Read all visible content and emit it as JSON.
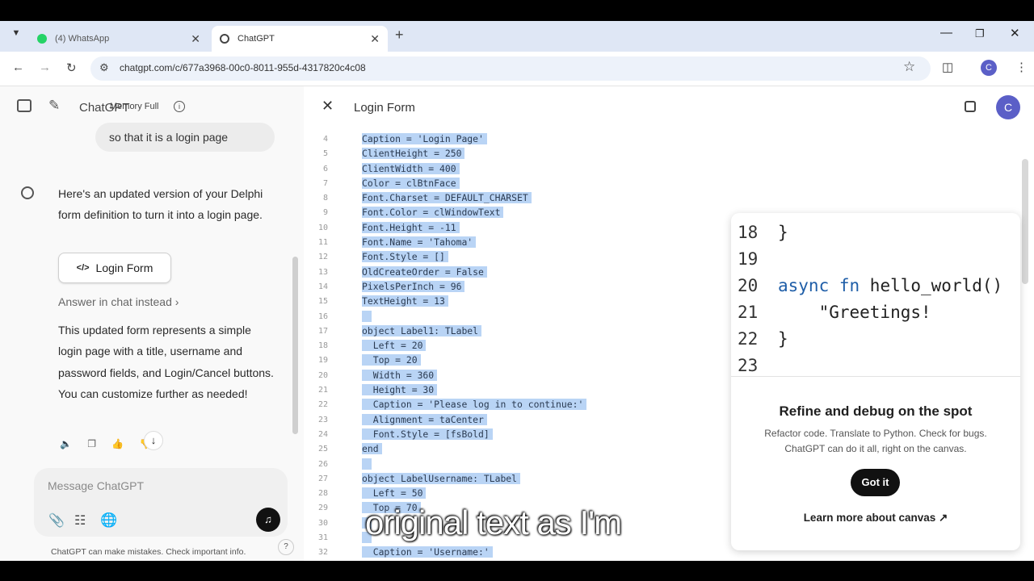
{
  "browser": {
    "tabs": [
      {
        "label": "(4) WhatsApp",
        "active": false
      },
      {
        "label": "ChatGPT",
        "active": true
      }
    ],
    "url": "chatgpt.com/c/677a3968-00c0-8011-955d-4317820c4c08",
    "profile_initial": "C"
  },
  "sidebar": {
    "app_name": "ChatGPT",
    "memory_label": "Memory Full",
    "user_message_tail": "so that it is a login page",
    "assistant_intro": "Here's an updated version of your Delphi form definition to turn it into a login page.",
    "card_label": "Login Form",
    "answer_in_chat": "Answer in chat instead",
    "assistant_body": "This updated form represents a simple login page with a title, username and password fields, and Login/Cancel buttons. You can customize further as needed!",
    "composer_placeholder": "Message ChatGPT",
    "disclaimer": "ChatGPT can make mistakes. Check important info.",
    "help": "?"
  },
  "canvas": {
    "title": "Login Form",
    "avatar_initial": "C",
    "code_lines": [
      {
        "n": "4",
        "text": "Caption = 'Login Page'"
      },
      {
        "n": "5",
        "text": "ClientHeight = 250"
      },
      {
        "n": "6",
        "text": "ClientWidth = 400"
      },
      {
        "n": "7",
        "text": "Color = clBtnFace"
      },
      {
        "n": "8",
        "text": "Font.Charset = DEFAULT_CHARSET"
      },
      {
        "n": "9",
        "text": "Font.Color = clWindowText"
      },
      {
        "n": "10",
        "text": "Font.Height = -11"
      },
      {
        "n": "11",
        "text": "Font.Name = 'Tahoma'"
      },
      {
        "n": "12",
        "text": "Font.Style = []"
      },
      {
        "n": "13",
        "text": "OldCreateOrder = False"
      },
      {
        "n": "14",
        "text": "PixelsPerInch = 96"
      },
      {
        "n": "15",
        "text": "TextHeight = 13"
      },
      {
        "n": "16",
        "text": ""
      },
      {
        "n": "17",
        "text": "object Label1: TLabel"
      },
      {
        "n": "18",
        "text": "  Left = 20"
      },
      {
        "n": "19",
        "text": "  Top = 20"
      },
      {
        "n": "20",
        "text": "  Width = 360"
      },
      {
        "n": "21",
        "text": "  Height = 30"
      },
      {
        "n": "22",
        "text": "  Caption = 'Please log in to continue:'"
      },
      {
        "n": "23",
        "text": "  Alignment = taCenter"
      },
      {
        "n": "24",
        "text": "  Font.Style = [fsBold]"
      },
      {
        "n": "25",
        "text": "end"
      },
      {
        "n": "26",
        "text": ""
      },
      {
        "n": "27",
        "text": "object LabelUsername: TLabel"
      },
      {
        "n": "28",
        "text": "  Left = 50"
      },
      {
        "n": "29",
        "text": "  Top = 70"
      },
      {
        "n": "30",
        "text": ""
      },
      {
        "n": "31",
        "text": ""
      },
      {
        "n": "32",
        "text": "  Caption = 'Username:'"
      }
    ]
  },
  "popup": {
    "code_lines": [
      {
        "n": "18",
        "text": "}"
      },
      {
        "n": "19",
        "text": ""
      },
      {
        "n": "20",
        "kw": "async fn ",
        "text": "hello_world()"
      },
      {
        "n": "21",
        "text": "    \"Greetings!"
      },
      {
        "n": "22",
        "text": "}"
      },
      {
        "n": "23",
        "text": ""
      }
    ],
    "title": "Refine and debug on the spot",
    "body": "Refactor code. Translate to Python. Check for bugs. ChatGPT can do it all, right on the canvas.",
    "got_it": "Got it",
    "learn_more": "Learn more about canvas ↗"
  },
  "video_subtitle": "original text as I'm"
}
